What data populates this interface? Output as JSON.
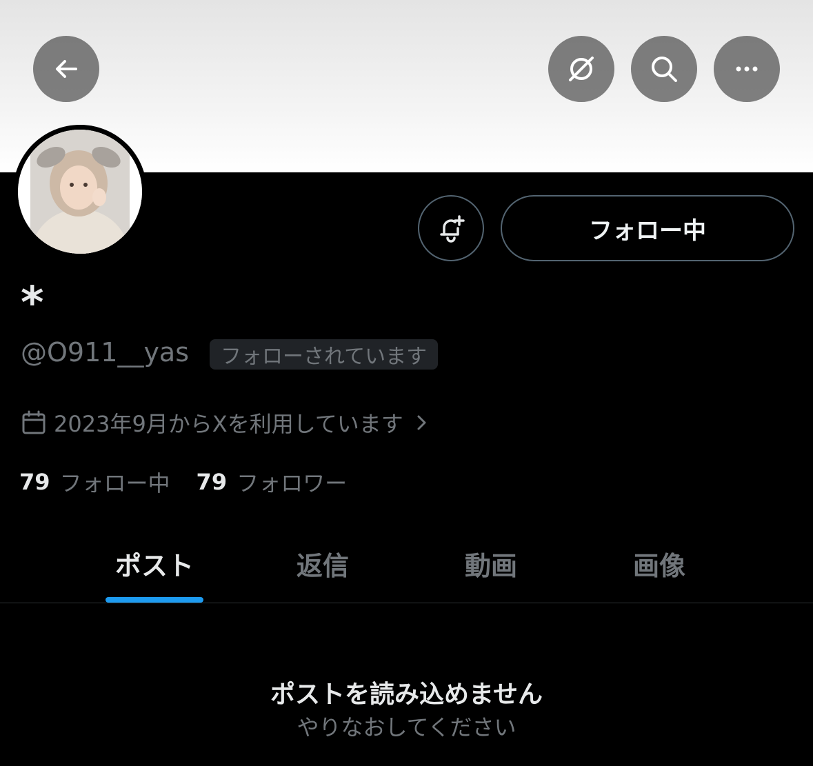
{
  "header": {
    "back_icon": "arrow-left-icon",
    "grok_icon": "grok-icon",
    "search_icon": "search-icon",
    "more_icon": "more-icon"
  },
  "profile": {
    "display_name": "*",
    "handle": "@O911__yas",
    "follows_you_badge": "フォローされています",
    "joined_text": "2023年9月からXを利用しています",
    "notify_icon": "bell-plus-icon",
    "follow_button_label": "フォロー中"
  },
  "stats": {
    "following_count": "79",
    "following_label": "フォロー中",
    "followers_count": "79",
    "followers_label": "フォロワー"
  },
  "tabs": [
    {
      "label": "ポスト",
      "active": true
    },
    {
      "label": "返信",
      "active": false
    },
    {
      "label": "動画",
      "active": false
    },
    {
      "label": "画像",
      "active": false
    }
  ],
  "empty_state": {
    "title": "ポストを読み込めません",
    "subtitle": "やりなおしてください"
  },
  "colors": {
    "accent": "#1d9bf0",
    "background": "#000000",
    "secondary_text": "#71767b"
  }
}
